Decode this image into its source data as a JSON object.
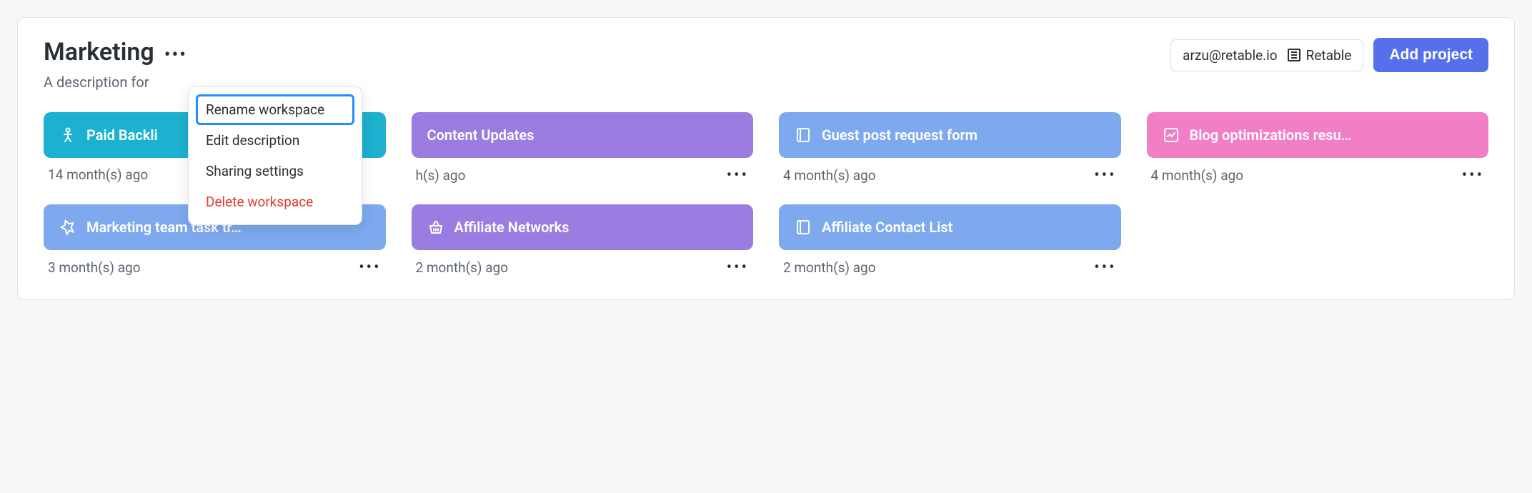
{
  "workspace": {
    "title": "Marketing",
    "description": "A description for"
  },
  "header": {
    "email": "arzu@retable.io",
    "org": "Retable",
    "add_project_label": "Add project"
  },
  "dropdown": {
    "items": [
      {
        "label": "Rename workspace",
        "selected": true,
        "danger": false
      },
      {
        "label": "Edit description",
        "selected": false,
        "danger": false
      },
      {
        "label": "Sharing settings",
        "selected": false,
        "danger": false
      },
      {
        "label": "Delete workspace",
        "selected": false,
        "danger": true
      }
    ]
  },
  "projects": [
    {
      "name": "Paid Backli",
      "time": "14 month(s) ago",
      "color": "c-teal",
      "icon": "person",
      "show_ellipsis": false
    },
    {
      "name": "Content Updates",
      "time": "h(s) ago",
      "color": "c-purple",
      "icon": "none",
      "show_ellipsis": true
    },
    {
      "name": "Guest post request form",
      "time": "4 month(s) ago",
      "color": "c-blue",
      "icon": "book",
      "show_ellipsis": true
    },
    {
      "name": "Blog optimizations resu…",
      "time": "4 month(s) ago",
      "color": "c-pink",
      "icon": "chart",
      "show_ellipsis": true
    },
    {
      "name": "Marketing team task tr…",
      "time": "3 month(s) ago",
      "color": "c-blue",
      "icon": "tag",
      "show_ellipsis": true
    },
    {
      "name": "Affiliate Networks",
      "time": "2 month(s) ago",
      "color": "c-purple",
      "icon": "basket",
      "show_ellipsis": true
    },
    {
      "name": "Affiliate Contact List",
      "time": "2 month(s) ago",
      "color": "c-blue",
      "icon": "book",
      "show_ellipsis": true
    }
  ]
}
